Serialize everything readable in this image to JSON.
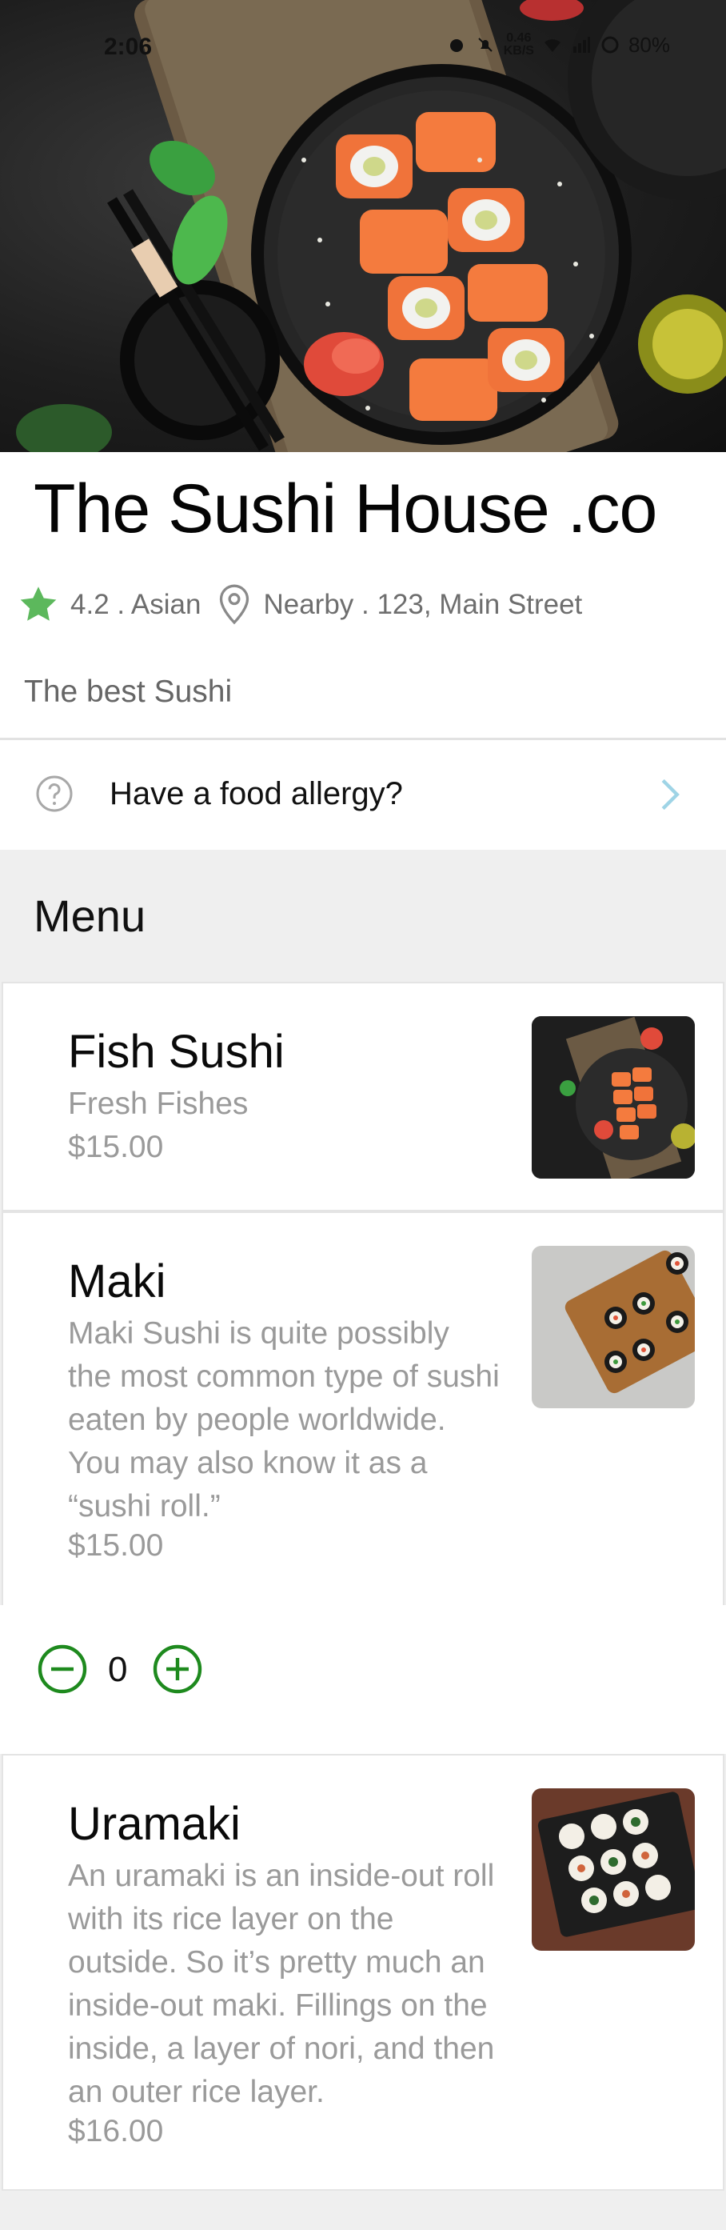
{
  "status": {
    "time": "2:06",
    "speed": "0.46",
    "speed_unit": "KB/S",
    "battery": "80%"
  },
  "restaurant": {
    "name": "The Sushi House .co",
    "rating": "4.2",
    "cuisine": "Asian",
    "rating_line": "4.2 . Asian",
    "location_line": "Nearby . 123, Main Street",
    "tagline": "The best Sushi"
  },
  "allergy": {
    "label": "Have a food allergy?"
  },
  "menu": {
    "heading": "Menu",
    "items": [
      {
        "name": "Fish Sushi",
        "description": "Fresh Fishes",
        "price": "$15.00"
      },
      {
        "name": "Maki",
        "description": "Maki Sushi is quite possibly the most common type of sushi eaten by people worldwide. You may also know it as a “sushi roll.”",
        "price": "$15.00"
      },
      {
        "name": "Uramaki",
        "description": "An uramaki is an inside-out roll with its rice layer on the outside. So it’s pretty much an inside-out maki. Fillings on the inside, a layer of nori, and then an outer rice layer.",
        "price": "$16.00"
      }
    ]
  },
  "quantity": {
    "value": "0"
  },
  "colors": {
    "accent_green": "#1e8a1e",
    "star_green": "#5cb85c",
    "chevron": "#9fd4e6"
  }
}
